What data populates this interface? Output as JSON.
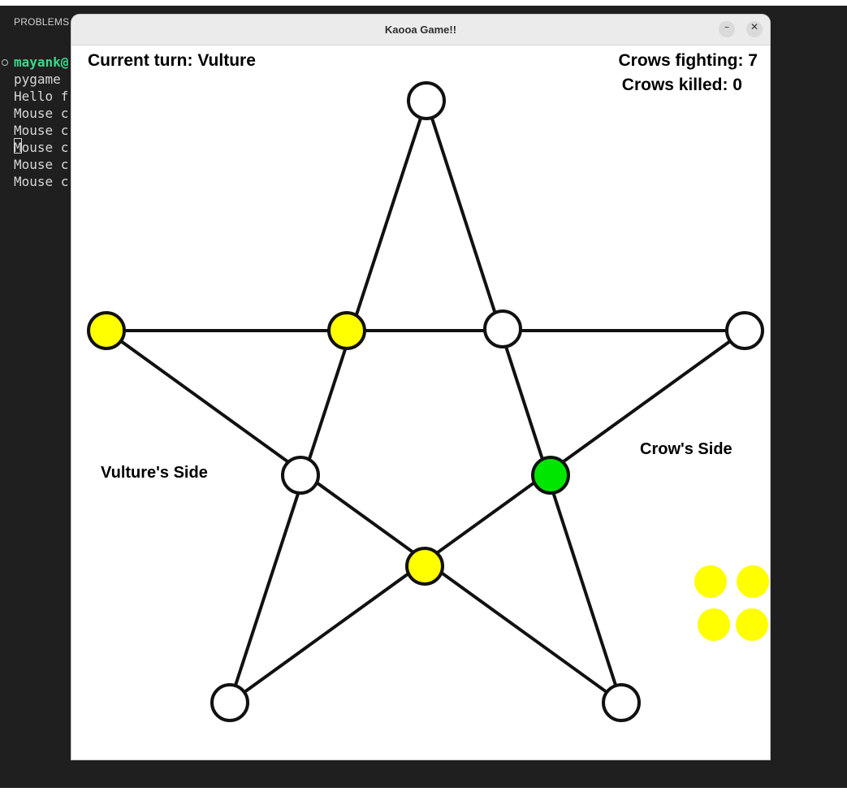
{
  "editor": {
    "problems_tab": "PROBLEMS",
    "terminal_lines": [
      {
        "text": "mayank@",
        "user": true,
        "dot": true
      },
      {
        "text": "pygame",
        "user": false
      },
      {
        "text": "Hello f",
        "user": false
      },
      {
        "text": "Mouse c",
        "user": false
      },
      {
        "text": "Mouse c",
        "user": false
      },
      {
        "text": "Mouse c",
        "user": false
      },
      {
        "text": "Mouse c",
        "user": false
      },
      {
        "text": "Mouse c",
        "user": false
      }
    ]
  },
  "window": {
    "title": "Kaooa Game!!",
    "minimize_glyph": "–",
    "close_glyph": "✕"
  },
  "hud": {
    "current_turn": "Current turn: Vulture",
    "crows_fighting": "Crows fighting: 7",
    "crows_killed": "Crows killed: 0",
    "vulture_side": "Vulture's Side",
    "crow_side": "Crow's Side"
  },
  "colors": {
    "empty": "#ffffff",
    "crow": "#ffff00",
    "vulture": "#00e600",
    "line": "#111111"
  },
  "board": {
    "nodes": [
      {
        "id": "top",
        "state": "empty"
      },
      {
        "id": "left-arm",
        "state": "crow"
      },
      {
        "id": "upper-inner-left",
        "state": "crow"
      },
      {
        "id": "upper-inner-right",
        "state": "empty"
      },
      {
        "id": "right-arm",
        "state": "empty"
      },
      {
        "id": "mid-inner-left",
        "state": "empty"
      },
      {
        "id": "mid-inner-right",
        "state": "vulture"
      },
      {
        "id": "bottom-inner",
        "state": "crow"
      },
      {
        "id": "bottom-left",
        "state": "empty"
      },
      {
        "id": "bottom-right",
        "state": "empty"
      }
    ],
    "reserve_crows": 4
  }
}
